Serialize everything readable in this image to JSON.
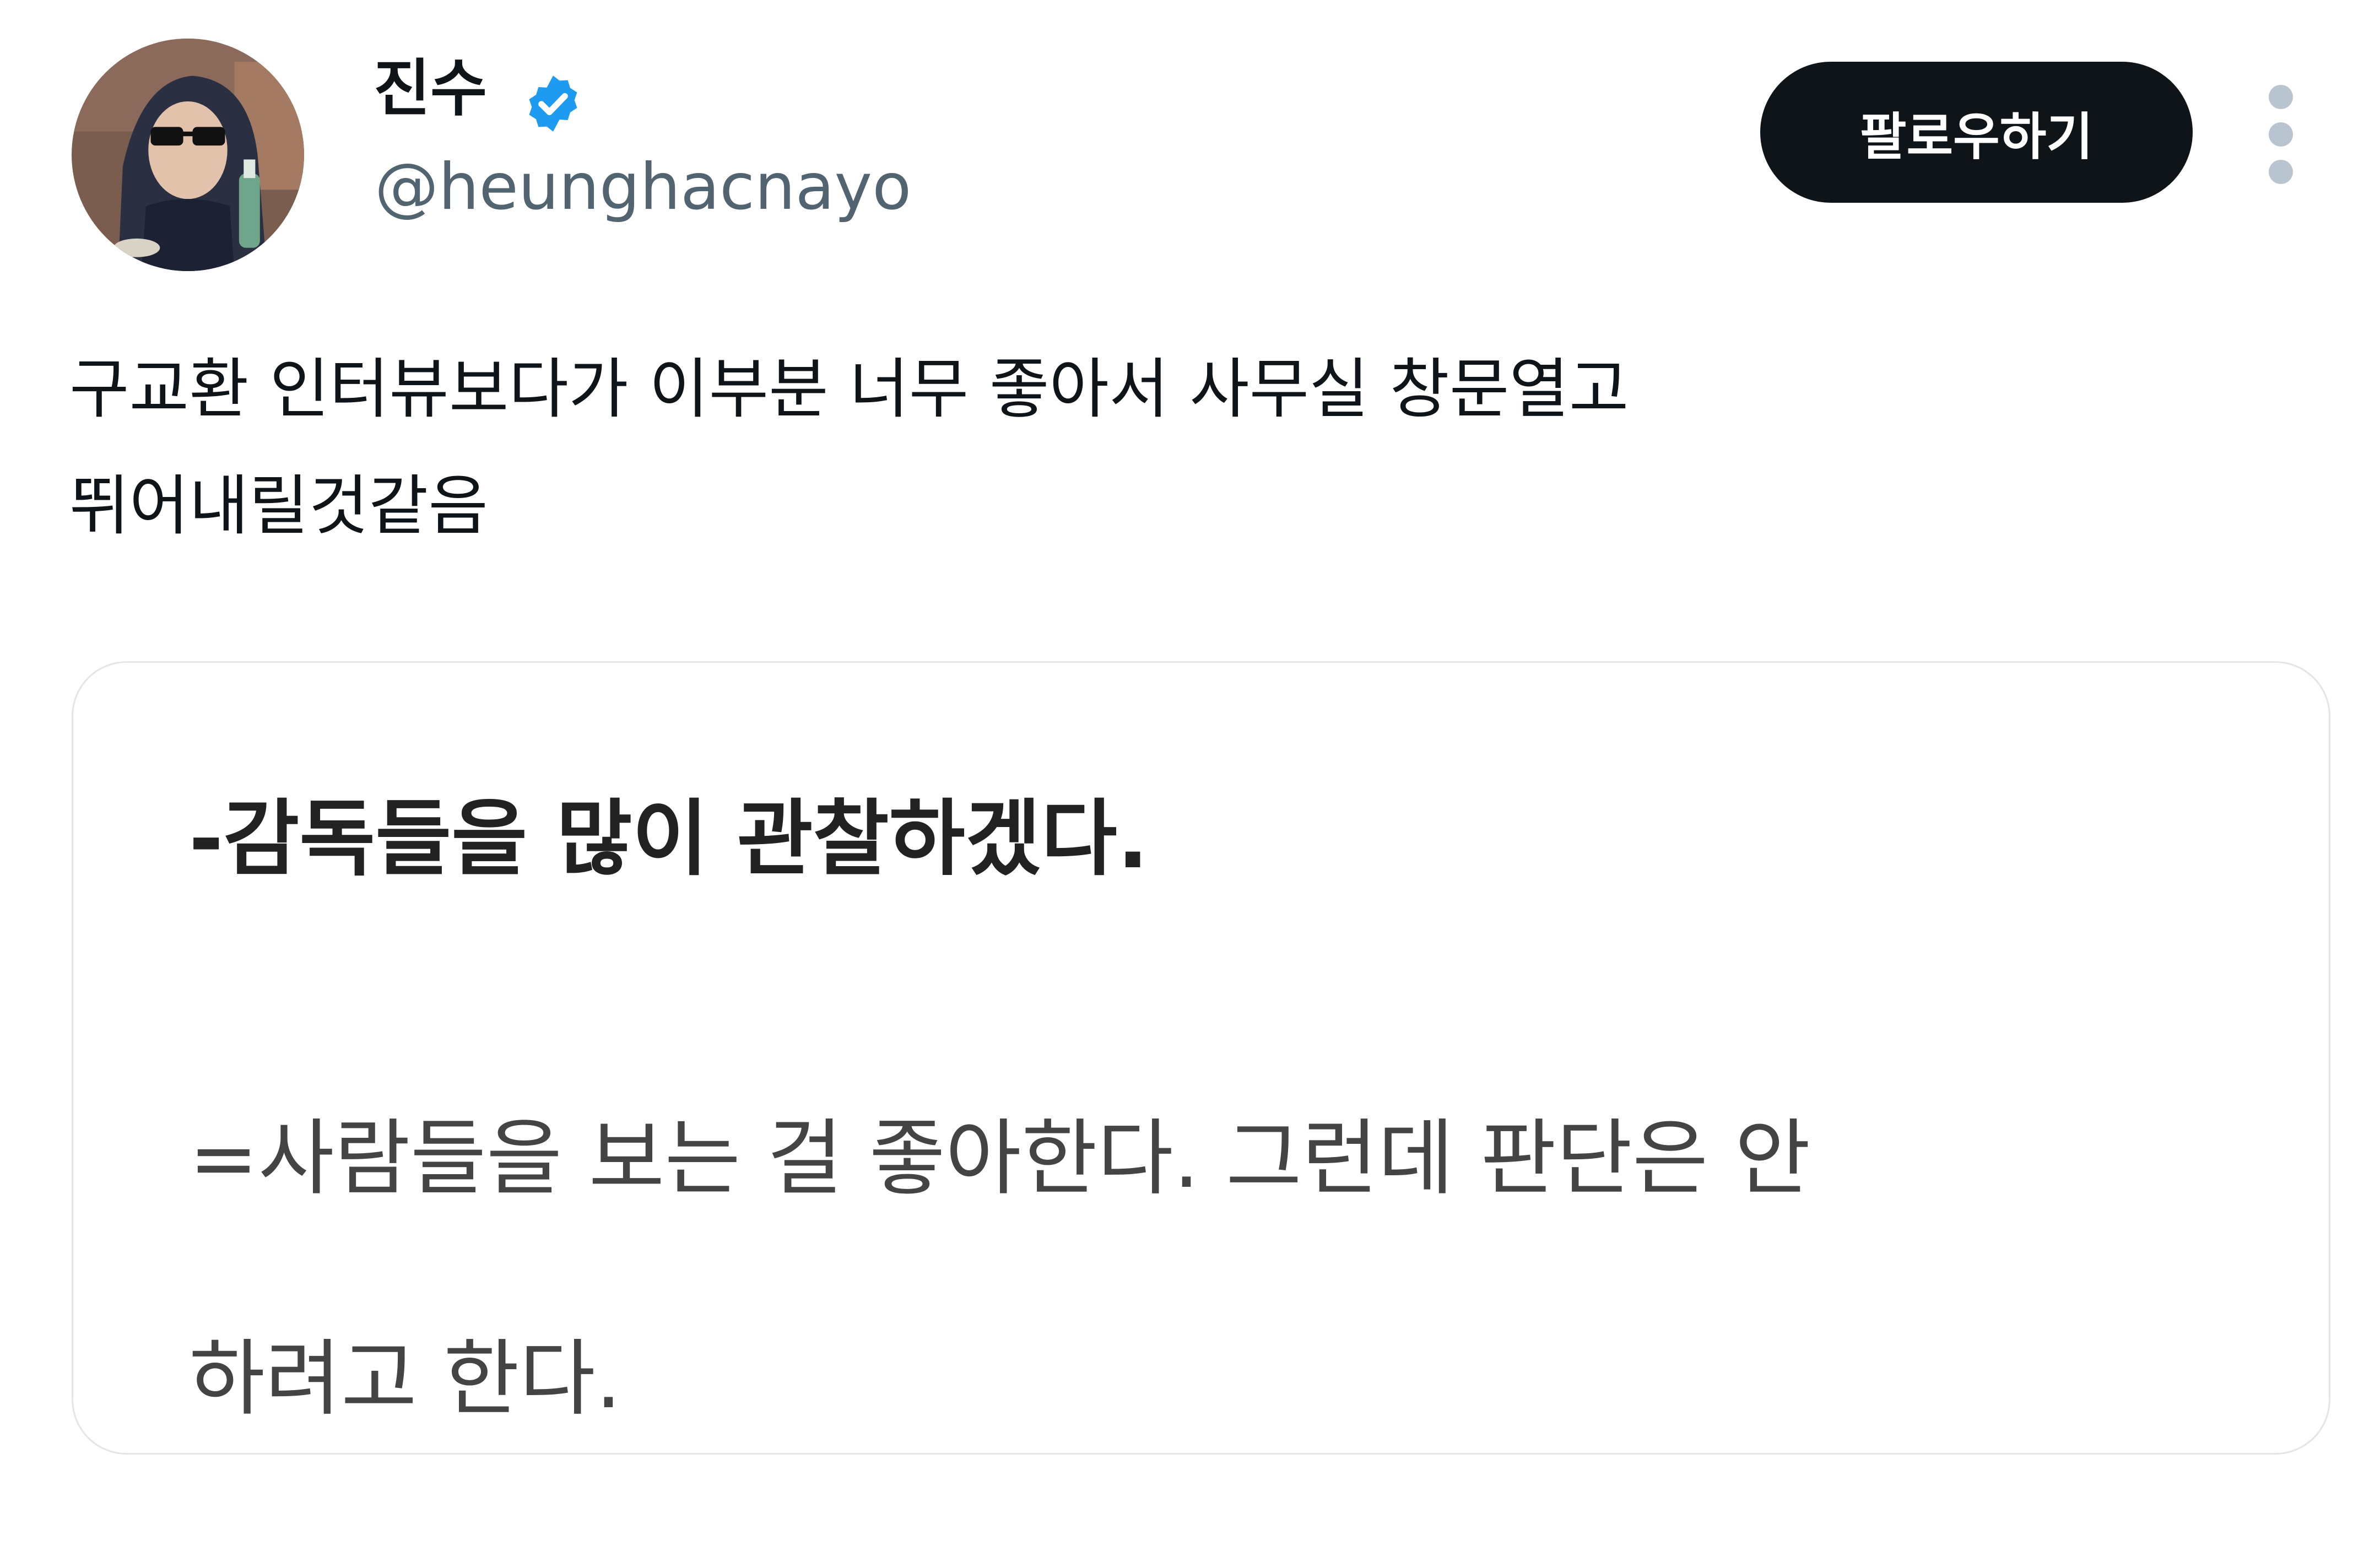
{
  "author": {
    "display_name": "진수",
    "handle": "@heunghacnayo",
    "verified": true,
    "avatar_icon": "profile-photo"
  },
  "follow_button": {
    "label": "팔로우하기"
  },
  "more_icon": "more-vertical-icon",
  "tweet": {
    "text_lines": [
      "구교환 인터뷰보다가 이부분 너무 좋아서 사무실 창문열고",
      "뛰어내릴것같음"
    ]
  },
  "media_card": {
    "question": "-감독들을 많이 관찰하겠다.",
    "answer_lines": [
      "=사람들을 보는 걸 좋아한다. 그런데 판단은 안",
      "하려고 한다."
    ]
  },
  "colors": {
    "text_primary": "#0f1419",
    "text_secondary": "#536471",
    "verified_blue": "#1d9bf0",
    "follow_bg": "#0f1419",
    "card_border": "#e3e6e9"
  }
}
